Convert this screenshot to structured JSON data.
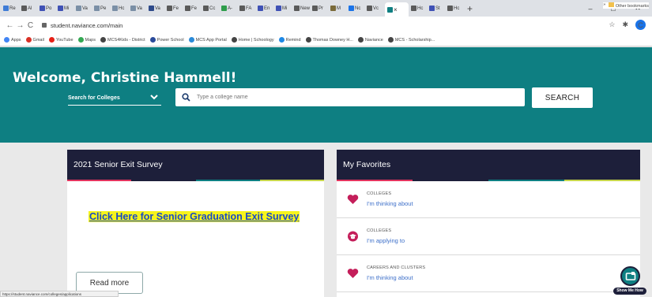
{
  "browser": {
    "tabs": [
      {
        "label": "Re",
        "color": "#3f7cd6"
      },
      {
        "label": "Al",
        "color": "#5a5a5a"
      },
      {
        "label": "Po",
        "color": "#3f51b5"
      },
      {
        "label": "Mi",
        "color": "#3f51b5"
      },
      {
        "label": "Va",
        "color": "#7a8fa6"
      },
      {
        "label": "Pe",
        "color": "#7a8fa6"
      },
      {
        "label": "Hc",
        "color": "#7a8fa6"
      },
      {
        "label": "Va",
        "color": "#7a8fa6"
      },
      {
        "label": "Va",
        "color": "#2e4a8a"
      },
      {
        "label": "Fe",
        "color": "#5a5a5a"
      },
      {
        "label": "Fe",
        "color": "#5a5a5a"
      },
      {
        "label": "Cc",
        "color": "#5a5a5a"
      },
      {
        "label": "A-",
        "color": "#2e9d4b"
      },
      {
        "label": "FA",
        "color": "#5a5a5a"
      },
      {
        "label": "En",
        "color": "#3f51b5"
      },
      {
        "label": "Mi",
        "color": "#3f51b5"
      },
      {
        "label": "New Ti",
        "color": "#5a5a5a"
      },
      {
        "label": "Pr",
        "color": "#5a5a5a"
      },
      {
        "label": "M",
        "color": "#7a6a3a"
      },
      {
        "label": "Nc",
        "color": "#1a73e8"
      },
      {
        "label": "Vc",
        "color": "#5a5a5a"
      }
    ],
    "active_tab": {
      "label": "",
      "close": "×"
    },
    "tabs_after": [
      {
        "label": "Hc",
        "color": "#5a5a5a"
      },
      {
        "label": "St",
        "color": "#3f51b5"
      },
      {
        "label": "Hc",
        "color": "#5a5a5a"
      }
    ],
    "new_tab": "+",
    "window_controls": {
      "minimize": "–",
      "maximize": "□",
      "close": "✕"
    },
    "nav": {
      "back": "←",
      "forward": "→",
      "reload": "C"
    },
    "url": "student.naviance.com/main",
    "toolbar_icons": {
      "star": "☆",
      "extensions": "✱",
      "profile": "C"
    },
    "bookmarks": [
      {
        "label": "Apps",
        "color": "#4285f4"
      },
      {
        "label": "Gmail",
        "color": "#d93025"
      },
      {
        "label": "YouTube",
        "color": "#e62117"
      },
      {
        "label": "Maps",
        "color": "#34a853"
      },
      {
        "label": "MCS4Kids - District",
        "color": "#444444"
      },
      {
        "label": "Power School",
        "color": "#2a4a9a"
      },
      {
        "label": "MCS App Portal",
        "color": "#2a8ad8"
      },
      {
        "label": "Home | Schoology",
        "color": "#444444"
      },
      {
        "label": "Remind",
        "color": "#1e88e5"
      },
      {
        "label": "Thomas Downey H...",
        "color": "#444444"
      },
      {
        "label": "Naviance",
        "color": "#444444"
      },
      {
        "label": "MCS - Scholarship...",
        "color": "#444444"
      }
    ],
    "bookmarks_more": "»",
    "other_bookmarks": "Other bookmarks",
    "status_url": "https://student.naviance.com/colleges/applications"
  },
  "header": {
    "welcome": "Welcome, Christine Hammell!",
    "search_type": "Search for Colleges",
    "search_placeholder": "Type a college name",
    "search_button": "SEARCH",
    "bg_color": "#0e7f82"
  },
  "survey_card": {
    "title": "2021 Senior Exit Survey",
    "link": "Click Here for Senior Graduation Exit Survey",
    "read_more": "Read more"
  },
  "favorites_card": {
    "title": "My Favorites",
    "items": [
      {
        "category": "COLLEGES",
        "link": "I'm thinking about",
        "icon": "heart-icon"
      },
      {
        "category": "COLLEGES",
        "link": "I'm applying to",
        "icon": "graduation-cap-icon"
      },
      {
        "category": "CAREERS AND CLUSTERS",
        "link": "I'm thinking about",
        "icon": "heart-icon"
      }
    ]
  },
  "stripe_colors": [
    "#e2345d",
    "#1d1f3a",
    "#0e7f82",
    "#c5d44a"
  ],
  "show_me_how": "Show Me How"
}
